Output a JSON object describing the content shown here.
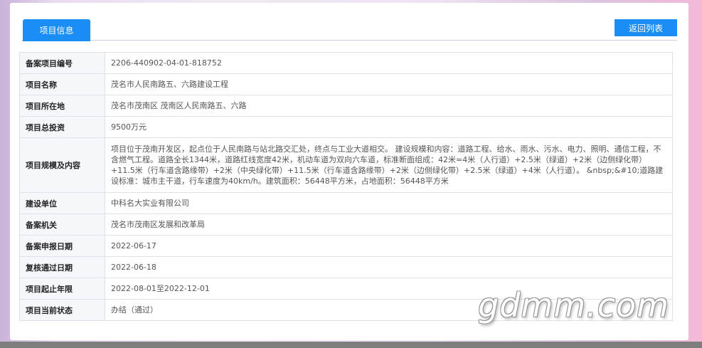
{
  "tabs": {
    "active_label": "项目信息"
  },
  "actions": {
    "back_label": "返回列表"
  },
  "rows": [
    {
      "label": "备案项目编号",
      "value": "2206-440902-04-01-818752"
    },
    {
      "label": "项目名称",
      "value": "茂名市人民南路五、六路建设工程"
    },
    {
      "label": "项目所在地",
      "value": "茂名市茂南区 茂南区人民南路五、六路"
    },
    {
      "label": "项目总投资",
      "value": "9500万元"
    },
    {
      "label": "项目规模及内容",
      "value": "项目位于茂南开发区，起点位于人民南路与站北路交汇处，终点与工业大道相交。 建设规模和内容：道路工程、给水、雨水、污水、电力、照明、通信工程，不含燃气工程。道路全长1344米，道路红线宽度42米，机动车道为双向六车道，标准断面组成：42米=4米（人行道）+2.5米（绿道）+2米（边侧绿化带）+11.5米（行车道含路缘带）+2米（中央绿化带）+11.5米（行车道含路缘带）+2米（边侧绿化带）+2.5米（绿道）+4米（人行道）。 &nbsp;&#10;道路建设标准：城市主干道，行车速度为40km/h。建筑面积：56448平方米，占地面积：56448平方米"
    },
    {
      "label": "建设单位",
      "value": "中科名大实业有限公司"
    },
    {
      "label": "备案机关",
      "value": "茂名市茂南区发展和改革局"
    },
    {
      "label": "备案申报日期",
      "value": "2022-06-17"
    },
    {
      "label": "复核通过日期",
      "value": "2022-06-18"
    },
    {
      "label": "项目起止年限",
      "value": "2022-08-01至2022-12-01"
    },
    {
      "label": "项目当前状态",
      "value": "办结（通过）"
    }
  ],
  "watermark": {
    "text": "gdmm.com"
  }
}
